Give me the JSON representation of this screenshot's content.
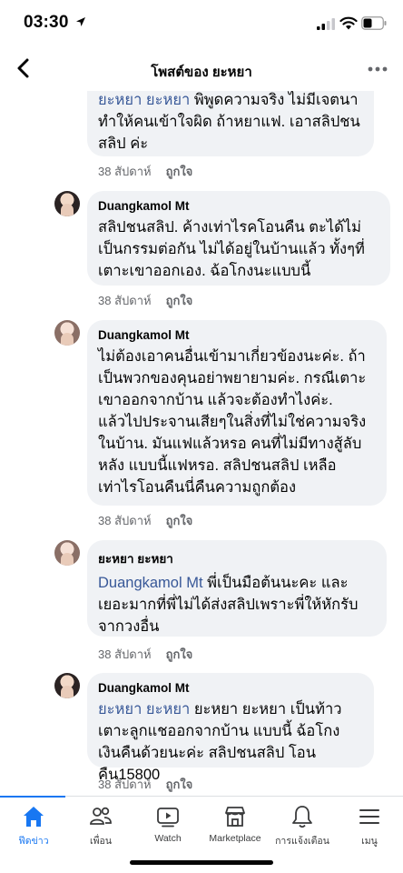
{
  "status_bar": {
    "time": "03:30"
  },
  "header": {
    "title": "โพสต์ของ ยะหยา"
  },
  "comments": [
    {
      "author": "",
      "mention": "ยะหยา ยะหยา",
      "text": " พิพูดความจริง ไม่มีเจตนาทำให้คนเข้าใจผิด ถ้าหยาแฟ.  เอาสลิปชนสลิป ค่ะ",
      "time": "38 สัปดาห์",
      "like": "ถูกใจ"
    },
    {
      "author": "Duangkamol Mt",
      "mention": "",
      "text": "สลิปชนสลิป. ค้างเท่าไรคโอนคืน ตะได้ไม่เป็นกรรมต่อกัน ไม่ได้อยู่ในบ้านแล้ว ทั้งๆที่เตาะเขาออกเอง. ฉ้อโกงนะแบบนี้",
      "time": "38 สัปดาห์",
      "like": "ถูกใจ"
    },
    {
      "author": "Duangkamol Mt",
      "mention": "",
      "text": "ไม่ต้องเอาคนอื่นเข้ามาเกี่ยวข้องนะค่ะ. ถ้าเป็นพวกของคุนอย่าพยายามค่ะ. กรณีเตาะเขาออกจากบ้าน แล้วจะต้องทำไงค่ะ. แล้วไปประจานเสียๆในสิ่งที่ไม่ใช่ความจริงในบ้าน. มันแฟแล้วหรอ คนที่ไม่มีทางสู้ลับหลัง แบบนี้แฟหรอ.  สลิปชนสลิป เหลือเท่าไรโอนคืนนี่คืนความถูกต้อง",
      "time": "38 สัปดาห์",
      "like": "ถูกใจ"
    },
    {
      "author": "ยะหยา ยะหยา",
      "mention": "Duangkamol Mt",
      "text": " พี่เป็นมือต้นนะคะ และเยอะมากที่พี่ไม่ได้ส่งสลิปเพราะพี่ให้หักรับจากวงอื่น",
      "time": "38 สัปดาห์",
      "like": "ถูกใจ"
    },
    {
      "author": "Duangkamol Mt",
      "mention": "ยะหยา ยะหยา",
      "text": " ยะหยา ยะหยา  เป็นท้าวเตาะลูกแชออกจากบ้าน แบบนี้ ฉ้อโกง เงินคืนด้วยนะค่ะ สลิปชนสลิป โอนคืน15800",
      "time": "38 สัปดาห์",
      "like": "ถูกใจ"
    }
  ],
  "tabs": [
    {
      "label": "ฟีดข่าว",
      "icon": "home-icon",
      "active": true
    },
    {
      "label": "เพื่อน",
      "icon": "friends-icon",
      "active": false
    },
    {
      "label": "Watch",
      "icon": "watch-icon",
      "active": false
    },
    {
      "label": "Marketplace",
      "icon": "marketplace-icon",
      "active": false
    },
    {
      "label": "การแจ้งเตือน",
      "icon": "bell-icon",
      "active": false
    },
    {
      "label": "เมนู",
      "icon": "menu-icon",
      "active": false
    }
  ],
  "colors": {
    "accent": "#1877f2",
    "mention": "#385898",
    "bubble": "#f0f2f5",
    "meta": "#65676b"
  }
}
